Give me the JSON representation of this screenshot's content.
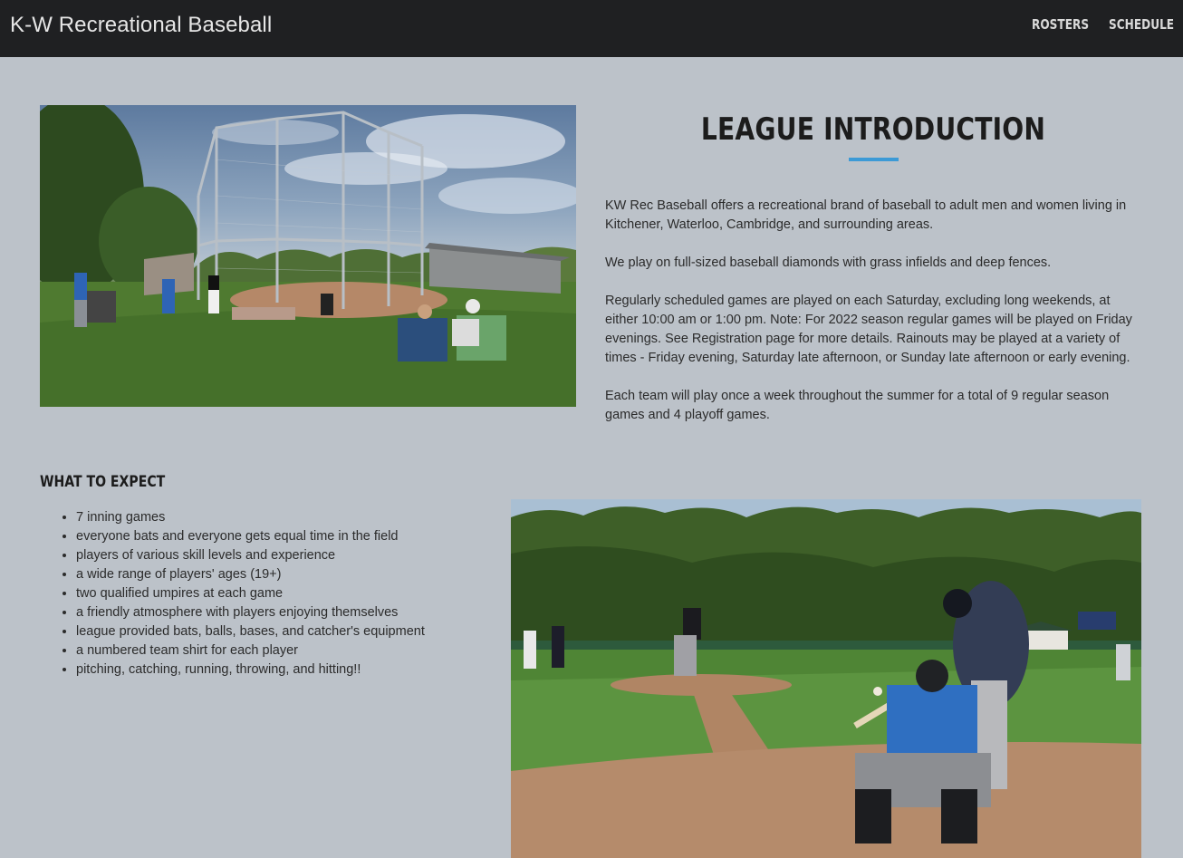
{
  "nav": {
    "brand": "K-W Recreational Baseball",
    "links": [
      "ROSTERS",
      "SCHEDULE"
    ]
  },
  "intro": {
    "title": "LEAGUE INTRODUCTION",
    "paragraphs": [
      "KW Rec Baseball offers a recreational brand of baseball to adult men and women living in Kitchener, Waterloo, Cambridge, and surrounding areas.",
      "We play on full-sized baseball diamonds with grass infields and deep fences.",
      "Regularly scheduled games are played on each Saturday, excluding long weekends, at either 10:00 am or 1:00 pm. Note: For 2022 season regular games will be played on Friday evenings. See Registration page for more details. Rainouts may be played at a variety of times - Friday evening, Saturday late afternoon, or Sunday late afternoon or early evening.",
      "Each team will play once a week throughout the summer for a total of 9 regular season games and 4 playoff games."
    ]
  },
  "expect": {
    "title": "WHAT TO EXPECT",
    "items": [
      "7 inning games",
      "everyone bats and everyone gets equal time in the field",
      "players of various skill levels and experience",
      "a wide range of players' ages (19+)",
      "two qualified umpires at each game",
      "a friendly atmosphere with players enjoying themselves",
      "league provided bats, balls, bases, and catcher's equipment",
      "a numbered team shirt for each player",
      "pitching, catching, running, throwing, and hitting!!"
    ]
  },
  "colors": {
    "navbar": "#1f2022",
    "background": "#bcc2c9",
    "accent": "#3c9ad6"
  }
}
